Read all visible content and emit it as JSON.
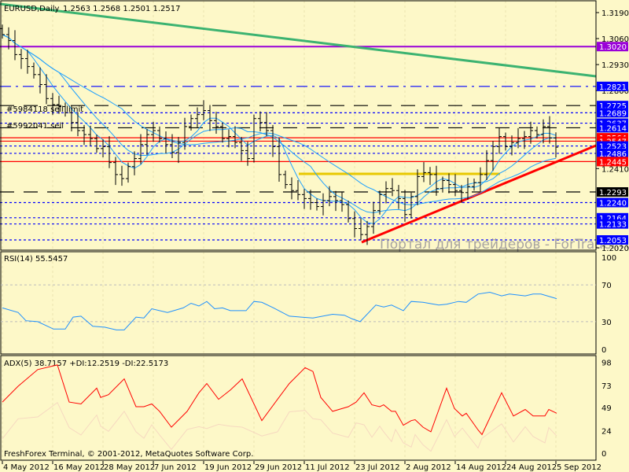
{
  "header": {
    "symbol_tf": "EURUSD,Daily",
    "ohlc": "1.2563 1.2568 1.2501 1.2517"
  },
  "orders": [
    "#5984118 sell limit",
    "#5992041 sell"
  ],
  "watermark": "Портал для трейдеров - ForTrader.ru",
  "copyright": "FreshForex Terminal, © 2001-2012, MetaQuotes Software Corp.",
  "colors": {
    "bg": "#fdf8c8",
    "candle": "#000000",
    "ma": "#1ea0ff",
    "rsi": "#1e90ff",
    "adx": "#ff0000",
    "purple": "#9a00d8",
    "green": "#3cb371",
    "blue_tag": "#0000ff",
    "red_tag": "#ff0000"
  },
  "chart_data": {
    "type": "line",
    "title": "EURUSD,Daily",
    "x_ticks": [
      "4 May 2012",
      "16 May 2012",
      "28 May 2012",
      "7 Jun 2012",
      "19 Jun 2012",
      "29 Jun 2012",
      "11 Jul 2012",
      "23 Jul 2012",
      "2 Aug 2012",
      "14 Aug 2012",
      "24 Aug 2012",
      "5 Sep 2012"
    ],
    "bars_per_tick": 8,
    "price_axis": {
      "max": 1.319,
      "min": 1.2053,
      "ticks": [
        "1.3190",
        "1.3060",
        "1.2930",
        "1.2800",
        "1.2410",
        "1.2020"
      ]
    },
    "close": [
      1.308,
      1.305,
      1.298,
      1.296,
      1.292,
      1.288,
      1.283,
      1.276,
      1.273,
      1.272,
      1.269,
      1.264,
      1.26,
      1.258,
      1.256,
      1.251,
      1.252,
      1.244,
      1.238,
      1.236,
      1.242,
      1.246,
      1.253,
      1.258,
      1.26,
      1.256,
      1.253,
      1.249,
      1.254,
      1.262,
      1.266,
      1.268,
      1.27,
      1.265,
      1.262,
      1.256,
      1.257,
      1.254,
      1.25,
      1.246,
      1.266,
      1.264,
      1.26,
      1.252,
      1.238,
      1.233,
      1.23,
      1.228,
      1.226,
      1.224,
      1.222,
      1.225,
      1.227,
      1.225,
      1.223,
      1.216,
      1.211,
      1.208,
      1.212,
      1.22,
      1.228,
      1.231,
      1.23,
      1.226,
      1.218,
      1.227,
      1.237,
      1.239,
      1.238,
      1.231,
      1.235,
      1.233,
      1.23,
      1.229,
      1.232,
      1.234,
      1.238,
      1.245,
      1.252,
      1.257,
      1.252,
      1.254,
      1.256,
      1.257,
      1.26,
      1.258,
      1.262,
      1.2563,
      1.2517
    ],
    "levels": [
      {
        "price": 1.302,
        "label": "1.3020",
        "color": "#9a00d8",
        "style": "solid",
        "tag": "#9a00d8"
      },
      {
        "price": 1.2821,
        "label": "1.2821",
        "color": "#0000ff",
        "style": "dashdot",
        "tag": "#0000ff"
      },
      {
        "price": 1.2725,
        "label": "1.2725",
        "color": "#000000",
        "style": "longdash",
        "tag": "#0000ff"
      },
      {
        "price": 1.2689,
        "label": "1.2689",
        "color": "#0000ff",
        "style": "dot",
        "tag": "#0000ff"
      },
      {
        "price": 1.2637,
        "label": "1.2637",
        "color": "#0000ff",
        "style": "dot",
        "tag": "#0000ff"
      },
      {
        "price": 1.2614,
        "label": "1.2614",
        "color": "#000000",
        "style": "longdash",
        "tag": "#0000ff"
      },
      {
        "price": 1.2564,
        "label": "1.2564",
        "color": "#ff0000",
        "style": "solid",
        "tag": "#ff0000"
      },
      {
        "price": 1.2547,
        "label": "1.2547",
        "color": "#ff0000",
        "style": "solid",
        "tag": "#ff0000"
      },
      {
        "price": 1.2523,
        "label": "1.2523",
        "color": "#0000ff",
        "style": "dot",
        "tag": "#0000ff"
      },
      {
        "price": 1.2486,
        "label": "1.2486",
        "color": "#0000ff",
        "style": "dot",
        "tag": "#0000ff"
      },
      {
        "price": 1.2445,
        "label": "1.2445",
        "color": "#ff0000",
        "style": "solid",
        "tag": "#ff0000"
      },
      {
        "price": 1.2293,
        "label": "1.2293",
        "color": "#000000",
        "style": "longdash",
        "tag": "#000000"
      },
      {
        "price": 1.224,
        "label": "1.2240",
        "color": "#0000ff",
        "style": "dot",
        "tag": "#0000ff"
      },
      {
        "price": 1.2164,
        "label": "1.2164",
        "color": "#0000ff",
        "style": "dot",
        "tag": "#0000ff"
      },
      {
        "price": 1.2133,
        "label": "1.2133",
        "color": "#0000ff",
        "style": "dot",
        "tag": "#0000ff"
      },
      {
        "price": 1.2053,
        "label": "1.2053",
        "color": "#0000ff",
        "style": "dot",
        "tag": "#0000ff"
      }
    ],
    "rsi": {
      "label": "RSI(14) 55.5457",
      "levels": [
        "100",
        "70",
        "30",
        "0"
      ],
      "points": [
        [
          0,
          45
        ],
        [
          4,
          40
        ],
        [
          6,
          31
        ],
        [
          9,
          30
        ],
        [
          13,
          22
        ],
        [
          16,
          22
        ],
        [
          18,
          35
        ],
        [
          20,
          36
        ],
        [
          23,
          25
        ],
        [
          26,
          24
        ],
        [
          29,
          21
        ],
        [
          31,
          21
        ],
        [
          34,
          35
        ],
        [
          36,
          34
        ],
        [
          38,
          44
        ],
        [
          42,
          40
        ],
        [
          46,
          45
        ],
        [
          48,
          50
        ],
        [
          50,
          47
        ],
        [
          52,
          52
        ],
        [
          54,
          44
        ],
        [
          56,
          45
        ],
        [
          58,
          42
        ],
        [
          62,
          42
        ],
        [
          64,
          52
        ],
        [
          66,
          51
        ],
        [
          69,
          45
        ],
        [
          73,
          36
        ],
        [
          76,
          35
        ],
        [
          79,
          34
        ],
        [
          84,
          38
        ],
        [
          87,
          37
        ],
        [
          89,
          33
        ],
        [
          91,
          30
        ],
        [
          95,
          48
        ],
        [
          97,
          46
        ],
        [
          99,
          48
        ],
        [
          102,
          42
        ],
        [
          104,
          52
        ],
        [
          107,
          51
        ],
        [
          111,
          48
        ],
        [
          113,
          49
        ],
        [
          116,
          52
        ],
        [
          118,
          51
        ],
        [
          121,
          60
        ],
        [
          124,
          62
        ],
        [
          127,
          58
        ],
        [
          129,
          60
        ],
        [
          133,
          58
        ],
        [
          135,
          60
        ],
        [
          137,
          60
        ],
        [
          141,
          55
        ]
      ]
    },
    "adx": {
      "label": "ADX(5) 38.7157 +DI:12.2519 -DI:22.5173",
      "levels": [
        "98",
        "73",
        "49",
        "24",
        "0"
      ],
      "points": [
        [
          0,
          55
        ],
        [
          4,
          72
        ],
        [
          9,
          90
        ],
        [
          14,
          95
        ],
        [
          17,
          55
        ],
        [
          20,
          53
        ],
        [
          24,
          70
        ],
        [
          25,
          60
        ],
        [
          27,
          63
        ],
        [
          31,
          80
        ],
        [
          34,
          50
        ],
        [
          36,
          50
        ],
        [
          38,
          53
        ],
        [
          40,
          45
        ],
        [
          43,
          28
        ],
        [
          47,
          45
        ],
        [
          50,
          65
        ],
        [
          52,
          75
        ],
        [
          55,
          58
        ],
        [
          58,
          68
        ],
        [
          61,
          80
        ],
        [
          66,
          35
        ],
        [
          70,
          58
        ],
        [
          73,
          75
        ],
        [
          77,
          92
        ],
        [
          79,
          88
        ],
        [
          81,
          60
        ],
        [
          84,
          45
        ],
        [
          88,
          50
        ],
        [
          90,
          55
        ],
        [
          92,
          65
        ],
        [
          94,
          52
        ],
        [
          96,
          50
        ],
        [
          97,
          52
        ],
        [
          99,
          45
        ],
        [
          100,
          45
        ],
        [
          102,
          30
        ],
        [
          104,
          35
        ],
        [
          105,
          36
        ],
        [
          107,
          28
        ],
        [
          109,
          23
        ],
        [
          113,
          70
        ],
        [
          115,
          48
        ],
        [
          117,
          40
        ],
        [
          118,
          43
        ],
        [
          121,
          25
        ],
        [
          122,
          20
        ],
        [
          127,
          65
        ],
        [
          130,
          40
        ],
        [
          133,
          47
        ],
        [
          135,
          40
        ],
        [
          138,
          40
        ],
        [
          139,
          47
        ],
        [
          141,
          43
        ]
      ]
    }
  },
  "footer": {
    "adx_zero": "0"
  }
}
